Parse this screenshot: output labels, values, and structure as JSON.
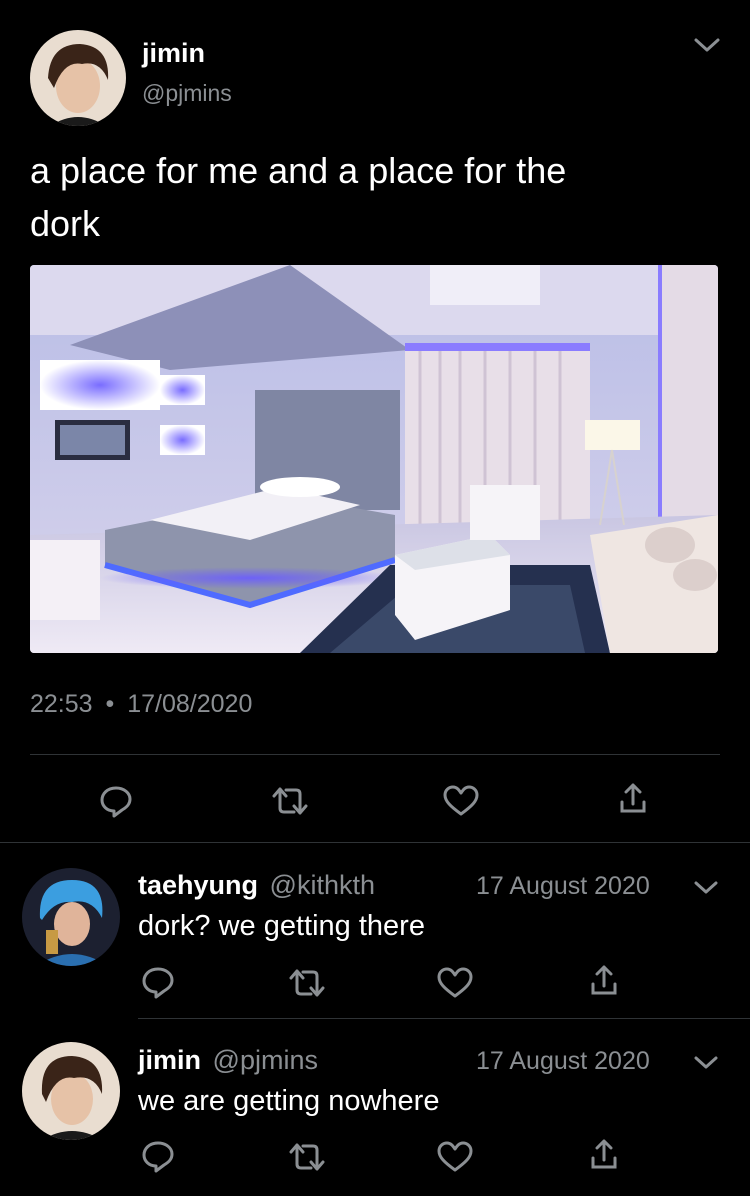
{
  "main_tweet": {
    "author_name": "jimin",
    "author_handle": "@pjmins",
    "text_line1": "a place for me and a place for the",
    "text_line2": "dork",
    "time": "22:53",
    "separator": "•",
    "date": "17/08/2020",
    "menu_icon": "chevron-down-icon",
    "actions": [
      "reply-icon",
      "retweet-icon",
      "like-icon",
      "share-icon"
    ]
  },
  "replies": [
    {
      "author_name": "taehyung",
      "author_handle": "@kithkth",
      "date": "17 August 2020",
      "text": "dork? we getting there"
    },
    {
      "author_name": "jimin",
      "author_handle": "@pjmins",
      "date": "17 August 2020",
      "text": "we are getting nowhere"
    }
  ],
  "colors": {
    "background": "#000000",
    "text": "#e7e9ea",
    "muted": "#8b8f93",
    "divider": "#2f3336"
  }
}
